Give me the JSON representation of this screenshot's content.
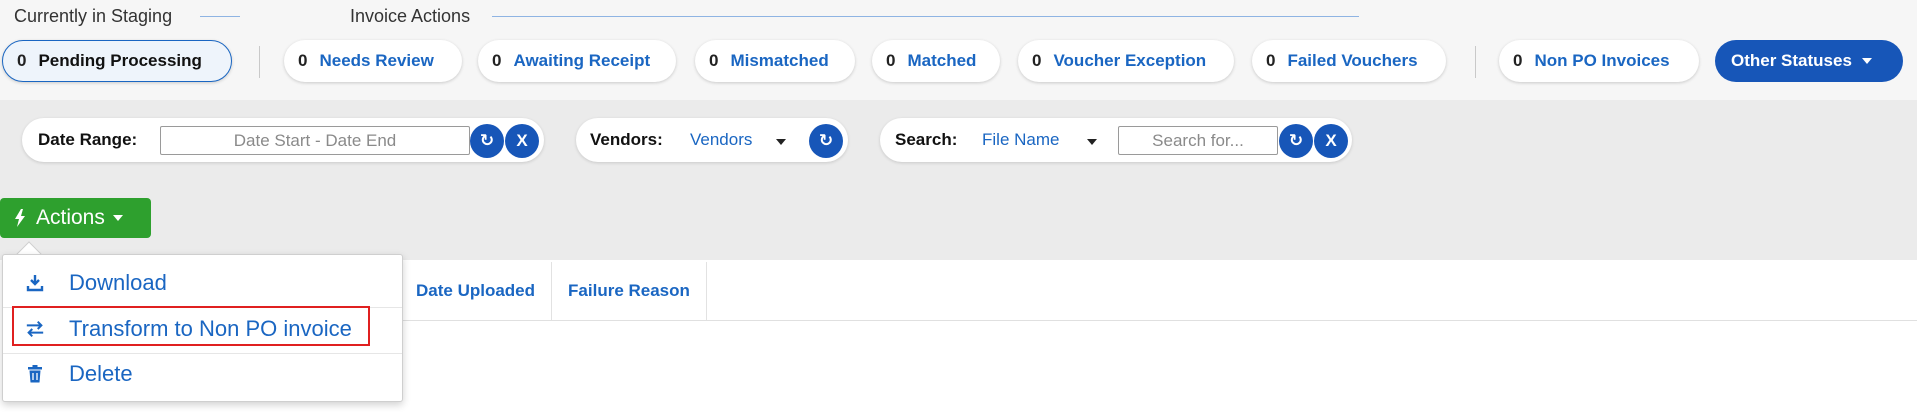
{
  "sections": {
    "staging_label": "Currently in Staging",
    "invoice_actions_label": "Invoice Actions"
  },
  "status_tabs": [
    {
      "count": "0",
      "label": "Pending Processing"
    },
    {
      "count": "0",
      "label": "Needs Review"
    },
    {
      "count": "0",
      "label": "Awaiting Receipt"
    },
    {
      "count": "0",
      "label": "Mismatched"
    },
    {
      "count": "0",
      "label": "Matched"
    },
    {
      "count": "0",
      "label": "Voucher Exception"
    },
    {
      "count": "0",
      "label": "Failed Vouchers"
    },
    {
      "count": "0",
      "label": "Non PO Invoices"
    }
  ],
  "other_statuses_label": "Other Statuses",
  "filters": {
    "date_range_label": "Date Range:",
    "date_range_placeholder": "Date Start - Date End",
    "vendors_label": "Vendors:",
    "vendors_value": "Vendors",
    "search_label": "Search:",
    "search_field_value": "File Name",
    "search_placeholder": "Search for...",
    "refresh_glyph": "↻",
    "clear_glyph": "X"
  },
  "actions": {
    "label": "Actions",
    "menu": [
      {
        "label": "Download",
        "icon": "download-icon"
      },
      {
        "label": "Transform to Non PO invoice",
        "icon": "transfer-arrows-icon"
      },
      {
        "label": "Delete",
        "icon": "trash-icon"
      }
    ]
  },
  "table": {
    "columns": [
      "Date Uploaded",
      "Failure Reason"
    ]
  },
  "colors": {
    "primary": "#1756b8",
    "link": "#1a66c2",
    "actions_green": "#2ea02e",
    "highlight_red": "#e02020"
  }
}
